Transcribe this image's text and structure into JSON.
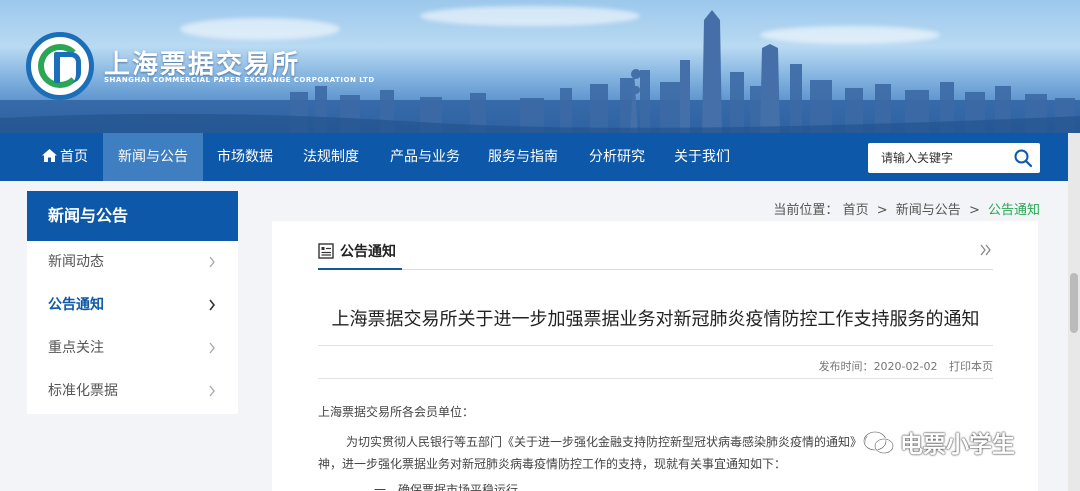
{
  "header": {
    "org_name": "上海票据交易所",
    "org_name_en": "SHANGHAI COMMERCIAL PAPER EXCHANGE CORPORATION LTD"
  },
  "nav": {
    "items": [
      {
        "label": "首页"
      },
      {
        "label": "新闻与公告"
      },
      {
        "label": "市场数据"
      },
      {
        "label": "法规制度"
      },
      {
        "label": "产品与业务"
      },
      {
        "label": "服务与指南"
      },
      {
        "label": "分析研究"
      },
      {
        "label": "关于我们"
      }
    ],
    "active_index": 1,
    "search_placeholder": "请输入关键字"
  },
  "sidebar": {
    "title": "新闻与公告",
    "items": [
      {
        "label": "新闻动态"
      },
      {
        "label": "公告通知"
      },
      {
        "label": "重点关注"
      },
      {
        "label": "标准化票据"
      }
    ],
    "active_index": 1
  },
  "breadcrumb": {
    "prefix": "当前位置：",
    "home": "首页",
    "parent": "新闻与公告",
    "current": "公告通知",
    "separator": ">"
  },
  "section": {
    "title": "公告通知"
  },
  "article": {
    "title": "上海票据交易所关于进一步加强票据业务对新冠肺炎疫情防控工作支持服务的通知",
    "publish_label": "发布时间：",
    "publish_date": "2020-02-02",
    "print_label": "打印本页",
    "salutation": "上海票据交易所各会员单位：",
    "para1_line1": "为切实贯彻人民银行等五部门《关于进一步强化金融支持防控新型冠状病毒感染肺炎疫情的通知》（",
    "para1_line2": "神，进一步强化票据业务对新冠肺炎病毒疫情防控工作的支持，现就有关事宜通知如下：",
    "para2_partial": "一、确保票据市场平稳运行"
  },
  "watermark": {
    "text": "电票小学生"
  },
  "colors": {
    "primary": "#0d58a8",
    "nav_active": "#3f7ec0",
    "accent_green": "#2aa654"
  }
}
